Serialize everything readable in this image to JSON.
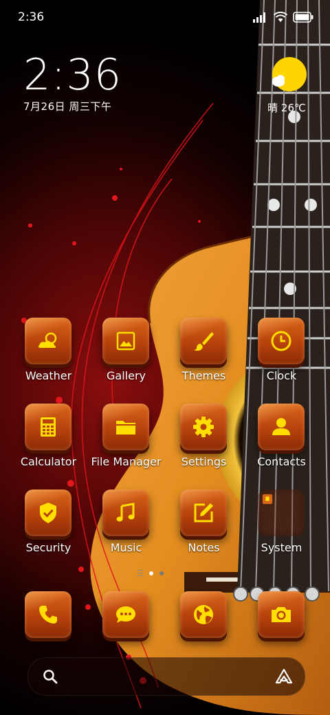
{
  "status_bar": {
    "time": "2:36"
  },
  "clock_widget": {
    "time": "2:36",
    "date": "7月26日 周三下午"
  },
  "weather_widget": {
    "text": "晴 26℃"
  },
  "apps": [
    {
      "label": "Weather",
      "icon": "weather-icon"
    },
    {
      "label": "Gallery",
      "icon": "gallery-icon"
    },
    {
      "label": "Themes",
      "icon": "brush-icon"
    },
    {
      "label": "Clock",
      "icon": "clock-icon"
    },
    {
      "label": "Calculator",
      "icon": "calculator-icon"
    },
    {
      "label": "File Manager",
      "icon": "folder-icon"
    },
    {
      "label": "Settings",
      "icon": "gear-icon"
    },
    {
      "label": "Contacts",
      "icon": "person-icon"
    },
    {
      "label": "Security",
      "icon": "shield-icon"
    },
    {
      "label": "Music",
      "icon": "music-icon"
    },
    {
      "label": "Notes",
      "icon": "edit-icon"
    },
    {
      "label": "System",
      "icon": "folder-group-icon"
    }
  ],
  "dock": [
    {
      "icon": "phone-icon"
    },
    {
      "icon": "message-icon"
    },
    {
      "icon": "browser-icon"
    },
    {
      "icon": "camera-icon"
    }
  ],
  "page_indicator": {
    "pages": 2,
    "active": 0
  },
  "search": {
    "placeholder": ""
  },
  "colors": {
    "accent": "#ffd400",
    "tile_orange": "#c8500f",
    "background_red": "#8a0e0e"
  }
}
